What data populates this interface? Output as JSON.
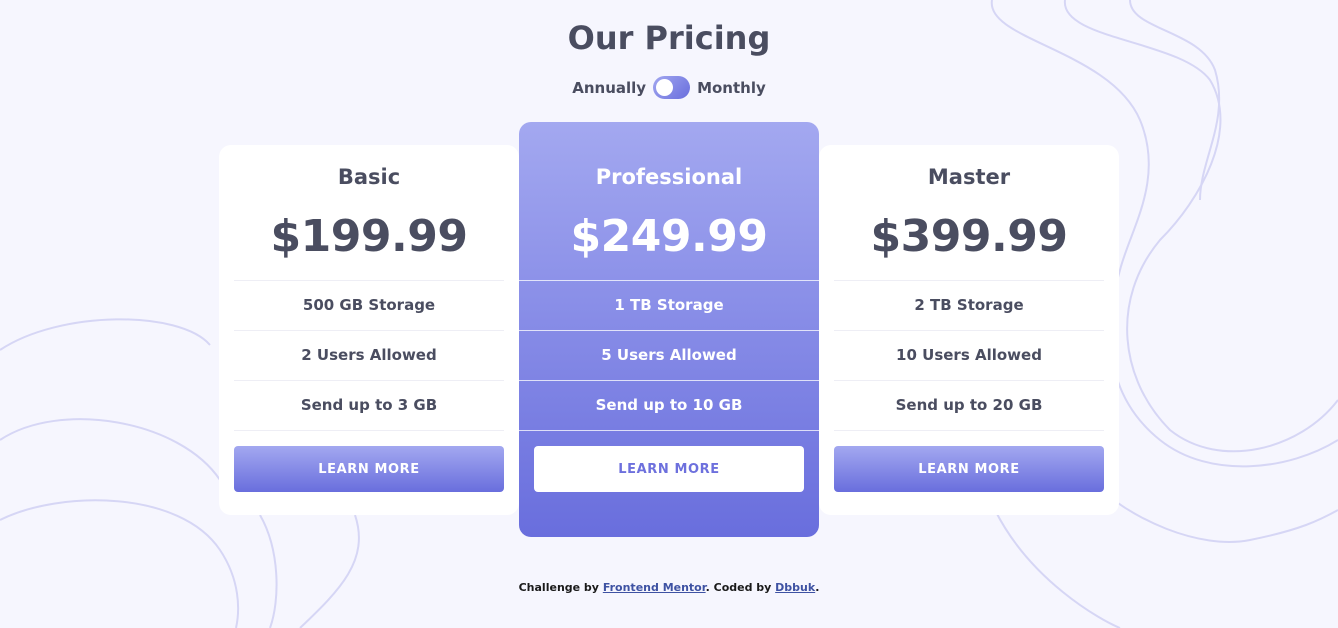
{
  "header": {
    "title": "Our Pricing",
    "toggle_left_label": "Annually",
    "toggle_right_label": "Monthly"
  },
  "plans": [
    {
      "name": "Basic",
      "price": "$199.99",
      "features": [
        "500 GB Storage",
        "2 Users Allowed",
        "Send up to 3 GB"
      ],
      "button_label": "LEARN MORE"
    },
    {
      "name": "Professional",
      "price": "$249.99",
      "features": [
        "1 TB Storage",
        "5 Users Allowed",
        "Send up to 10 GB"
      ],
      "button_label": "LEARN MORE"
    },
    {
      "name": "Master",
      "price": "$399.99",
      "features": [
        "2 TB Storage",
        "10 Users Allowed",
        "Send up to 20 GB"
      ],
      "button_label": "LEARN MORE"
    }
  ],
  "footer": {
    "prefix": "Challenge by ",
    "link1": "Frontend Mentor",
    "middle": ". Coded by ",
    "link2": "Dbbuk",
    "suffix": "."
  },
  "colors": {
    "background": "#f6f6fe",
    "accent_light": "#a3a8f0",
    "accent_dark": "#696edd",
    "text_dark": "#4a4d60",
    "link": "#3e52a3"
  }
}
